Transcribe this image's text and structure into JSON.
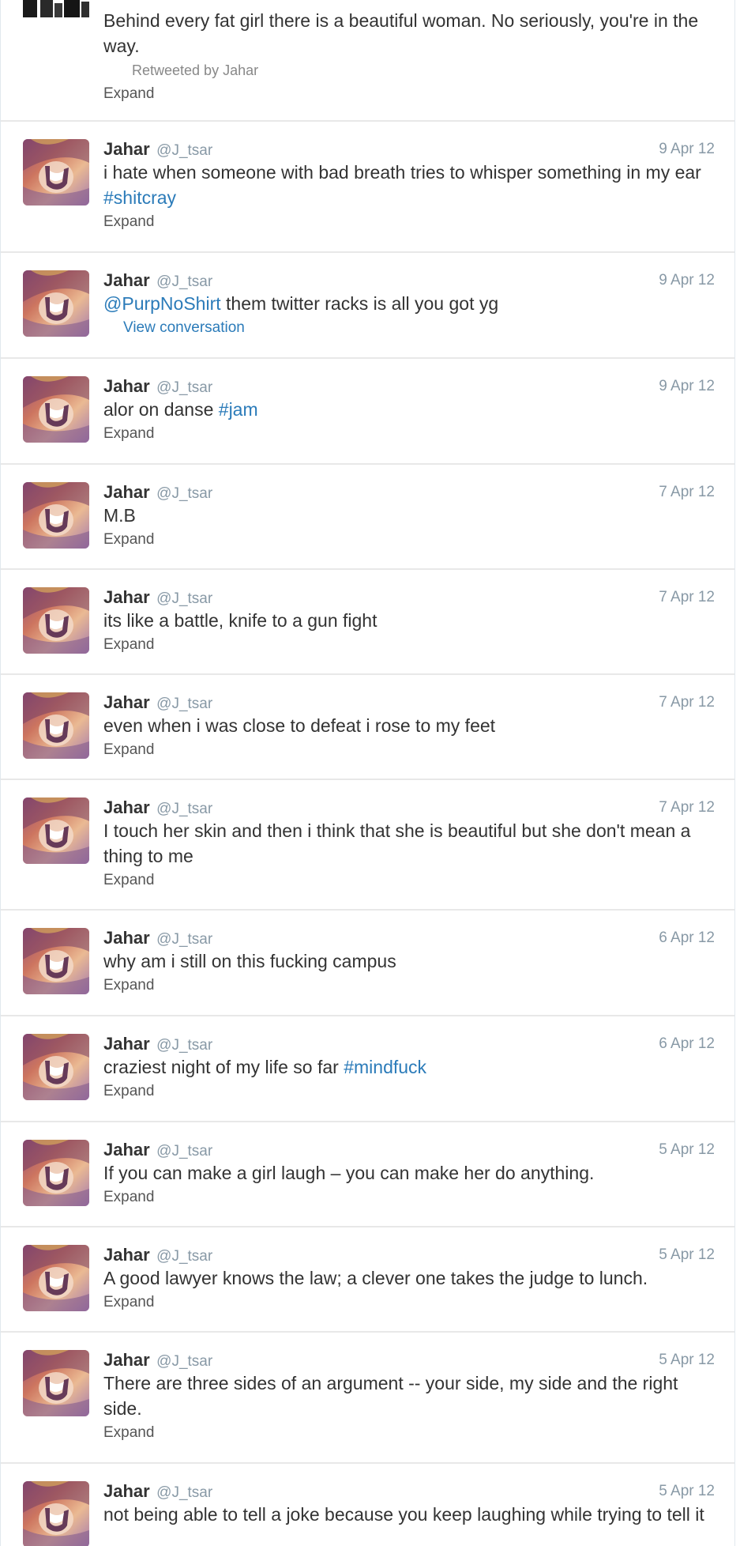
{
  "colors": {
    "link": "#2b7bb9",
    "secondary_text": "#8899a6",
    "divider": "#e8e8e8",
    "body_text": "#333333"
  },
  "first_tweet": {
    "text": "Behind every fat girl there is a beautiful woman. No seriously, you're in the way.",
    "retweeted_by": "Retweeted by Jahar",
    "expand": "Expand"
  },
  "tweets": [
    {
      "name": "Jahar",
      "handle": "@J_tsar",
      "time": "9 Apr 12",
      "text_before": "i hate when someone with bad breath tries to whisper something in my ear ",
      "tag": "#shitcray",
      "text_after": "",
      "action": "Expand"
    },
    {
      "name": "Jahar",
      "handle": "@J_tsar",
      "time": "9 Apr 12",
      "mention": "@PurpNoShirt",
      "text_after": " them twitter racks is all you got yg",
      "action": "View conversation"
    },
    {
      "name": "Jahar",
      "handle": "@J_tsar",
      "time": "9 Apr 12",
      "text_before": "alor on danse ",
      "tag": "#jam",
      "action": "Expand"
    },
    {
      "name": "Jahar",
      "handle": "@J_tsar",
      "time": "7 Apr 12",
      "text": "M.B",
      "action": "Expand"
    },
    {
      "name": "Jahar",
      "handle": "@J_tsar",
      "time": "7 Apr 12",
      "text": "its like a battle, knife to a gun fight",
      "action": "Expand"
    },
    {
      "name": "Jahar",
      "handle": "@J_tsar",
      "time": "7 Apr 12",
      "text": "even when i was close to defeat i rose to my feet",
      "action": "Expand"
    },
    {
      "name": "Jahar",
      "handle": "@J_tsar",
      "time": "7 Apr 12",
      "text": "I touch her skin and then i think that she is beautiful but she don't mean a thing to me",
      "action": "Expand"
    },
    {
      "name": "Jahar",
      "handle": "@J_tsar",
      "time": "6 Apr 12",
      "text": "why am i still on this fucking campus",
      "action": "Expand"
    },
    {
      "name": "Jahar",
      "handle": "@J_tsar",
      "time": "6 Apr 12",
      "text_before": "craziest night of my life so far ",
      "tag": "#mindfuck",
      "action": "Expand"
    },
    {
      "name": "Jahar",
      "handle": "@J_tsar",
      "time": "5 Apr 12",
      "text": "If you can make a girl laugh – you can make her do anything.",
      "action": "Expand"
    },
    {
      "name": "Jahar",
      "handle": "@J_tsar",
      "time": "5 Apr 12",
      "text": "A good lawyer knows the law; a clever one takes the judge to lunch.",
      "action": "Expand"
    },
    {
      "name": "Jahar",
      "handle": "@J_tsar",
      "time": "5 Apr 12",
      "text": "There are three sides of an argument -- your side, my side and the right side.",
      "action": "Expand"
    },
    {
      "name": "Jahar",
      "handle": "@J_tsar",
      "time": "5 Apr 12",
      "text": "not being able to tell a joke because you keep laughing while trying to tell it"
    }
  ]
}
